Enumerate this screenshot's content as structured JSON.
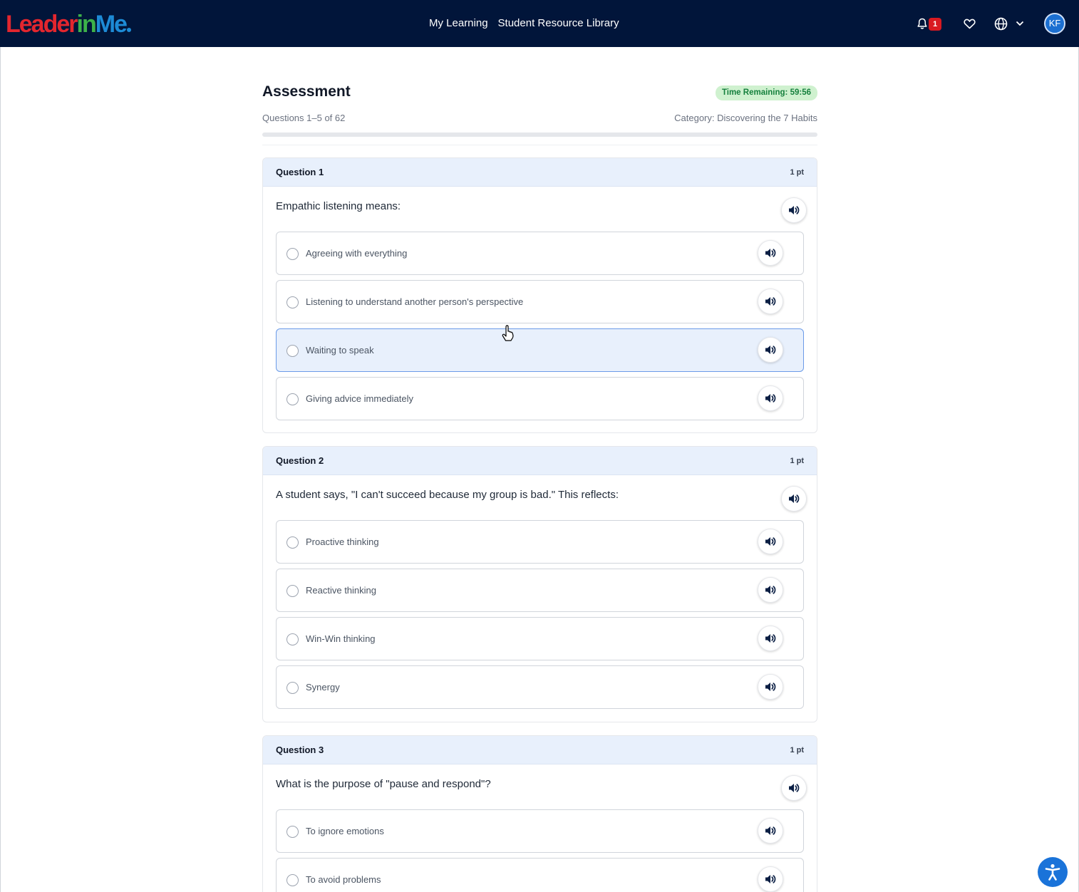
{
  "header": {
    "logo": {
      "part1": "Leader",
      "part2": "in",
      "part3": "Me"
    },
    "nav": [
      "My Learning",
      "Student Resource Library"
    ],
    "notification_count": "1",
    "user_initials": "KF",
    "icons": [
      "bell-icon",
      "heart-icon",
      "globe-icon",
      "chevron-down-icon"
    ]
  },
  "assessment": {
    "title": "Assessment",
    "time_remaining": "Time Remaining: 59:56",
    "progress_text": "Questions 1–5 of 62",
    "category": "Category: Discovering the 7 Habits",
    "progress_fraction": 0.0
  },
  "questions": [
    {
      "number": "Question 1",
      "points": "1 pt",
      "text": "Empathic listening means:",
      "options": [
        "Agreeing with everything",
        "Listening to understand another person's perspective",
        "Waiting to speak",
        "Giving advice immediately"
      ]
    },
    {
      "number": "Question 2",
      "points": "1 pt",
      "text": "A student says, \"I can't succeed because my group is bad.\" This reflects:",
      "options": [
        "Proactive thinking",
        "Reactive thinking",
        "Win-Win thinking",
        "Synergy"
      ]
    },
    {
      "number": "Question 3",
      "points": "1 pt",
      "text": "What is the purpose of \"pause and respond\"?",
      "options": [
        "To ignore emotions",
        "To avoid problems"
      ]
    }
  ],
  "colors": {
    "header_bg": "#01153a",
    "question_header_bg": "#e8f0fc",
    "timer_bg": "#cff1cf",
    "timer_text": "#15803d",
    "badge": "#d91a21",
    "accessibility": "#1a73d9"
  }
}
